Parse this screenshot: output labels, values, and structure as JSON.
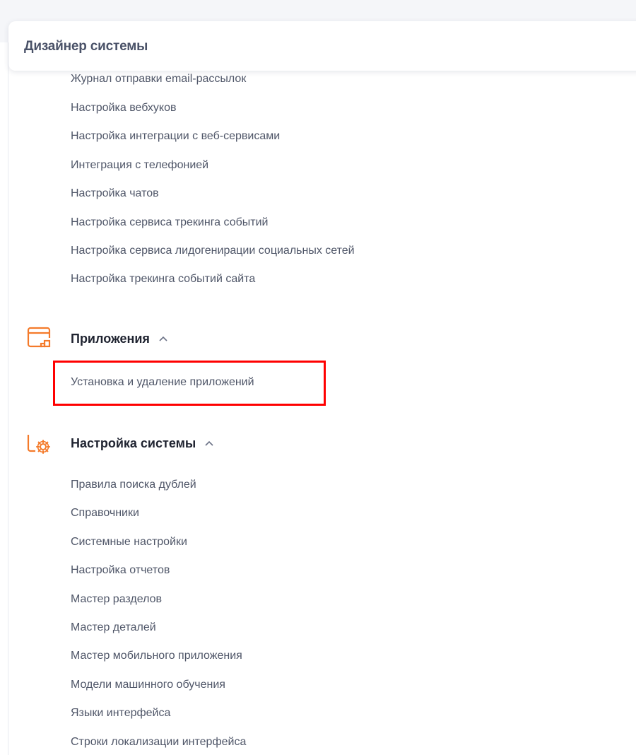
{
  "header": {
    "title": "Дизайнер системы"
  },
  "integrations": {
    "items": [
      "Журнал отправки email-рассылок",
      "Настройка вебхуков",
      "Настройка интеграции с веб-сервисами",
      "Интеграция с телефонией",
      "Настройка чатов",
      "Настройка сервиса трекинга событий",
      "Настройка сервиса лидогенирации социальных сетей",
      "Настройка трекинга событий сайта"
    ]
  },
  "applications": {
    "title": "Приложения",
    "icon": "apps-window-icon",
    "items": [
      "Установка и удаление приложений"
    ]
  },
  "system_settings": {
    "title": "Настройка системы",
    "icon": "settings-gear-window-icon",
    "items": [
      "Правила поиска дублей",
      "Справочники",
      "Системные настройки",
      "Настройка отчетов",
      "Мастер разделов",
      "Мастер деталей",
      "Мастер мобильного приложения",
      "Модели машинного обучения",
      "Языки интерфейса",
      "Строки локализации интерфейса"
    ]
  },
  "colors": {
    "accent_orange": "#f47a2a",
    "highlight_red": "#ff0000",
    "item_text": "#4f5668",
    "section_text": "#1f2330"
  }
}
